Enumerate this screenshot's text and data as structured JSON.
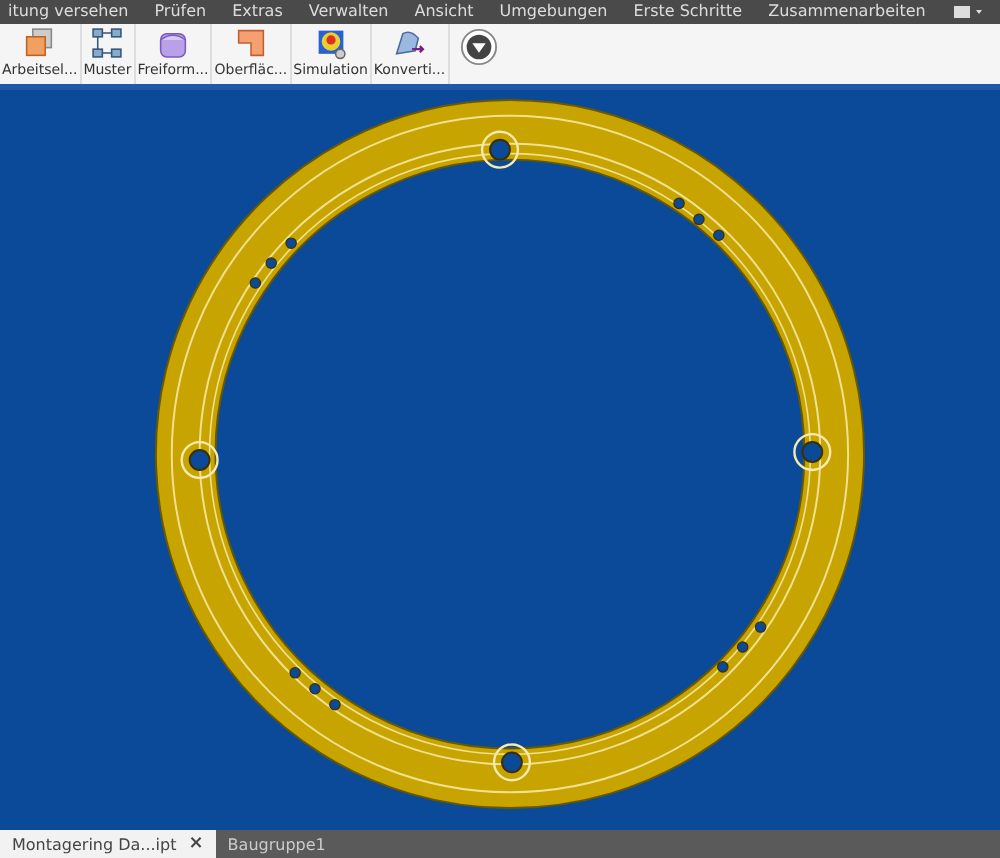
{
  "menu": [
    "itung versehen",
    "Prüfen",
    "Extras",
    "Verwalten",
    "Ansicht",
    "Umgebungen",
    "Erste Schritte",
    "Zusammenarbeiten"
  ],
  "ribbon": [
    {
      "label": "Arbeitsel...",
      "kind": "workplane"
    },
    {
      "label": "Muster",
      "kind": "pattern"
    },
    {
      "label": "Freiform...",
      "kind": "freeform"
    },
    {
      "label": "Oberfläc...",
      "kind": "surface"
    },
    {
      "label": "Simulation",
      "kind": "simulation"
    },
    {
      "label": "Konverti...",
      "kind": "convert"
    }
  ],
  "doc_tabs": [
    {
      "label": "Montagering Da...ipt",
      "close": "×",
      "selected": true
    },
    {
      "label": "Baugruppe1",
      "selected": false
    }
  ]
}
